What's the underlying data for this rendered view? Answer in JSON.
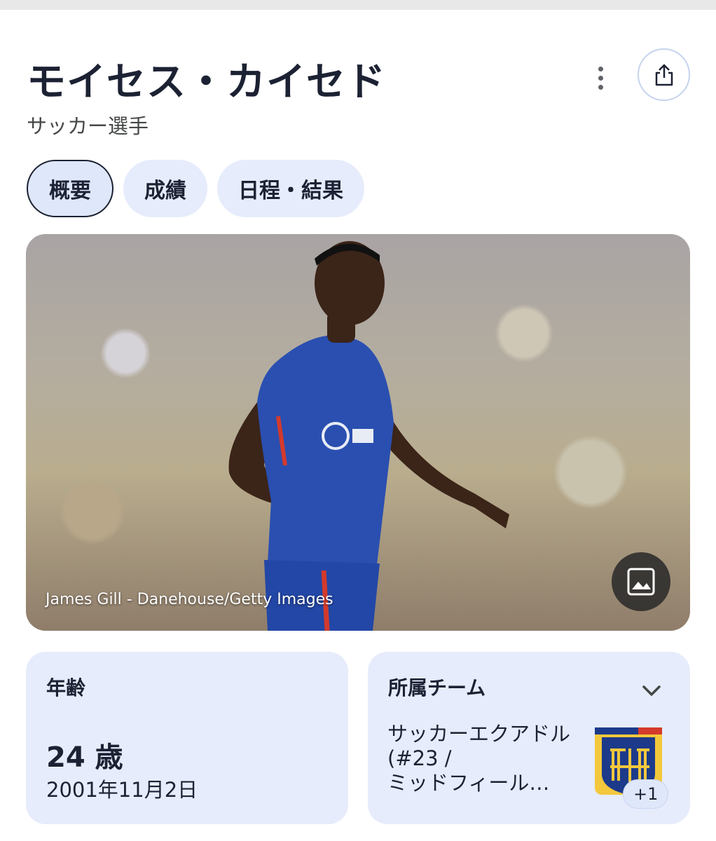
{
  "header": {
    "title": "モイセス・カイセド",
    "subtitle": "サッカー選手",
    "more_icon": "more-vert-icon",
    "share_icon": "share-icon"
  },
  "tabs": [
    {
      "label": "概要",
      "active": true
    },
    {
      "label": "成績",
      "active": false
    },
    {
      "label": "日程・結果",
      "active": false
    }
  ],
  "photo": {
    "caption": "James Gill - Danehouse/Getty Images",
    "image_icon": "image-icon"
  },
  "age_card": {
    "label": "年齢",
    "value": "24 歳",
    "birth_date": "2001年11月2日"
  },
  "team_card": {
    "label": "所属チーム",
    "team_lines": [
      "サッカーエクアドル",
      "(#23 /",
      "ミッドフィール…"
    ],
    "extra_count": "+1",
    "chevron_icon": "chevron-down-icon"
  },
  "colors": {
    "accent_bg": "#e6ecfb",
    "text_dark": "#1c2233",
    "share_border": "#c6d3ee"
  }
}
